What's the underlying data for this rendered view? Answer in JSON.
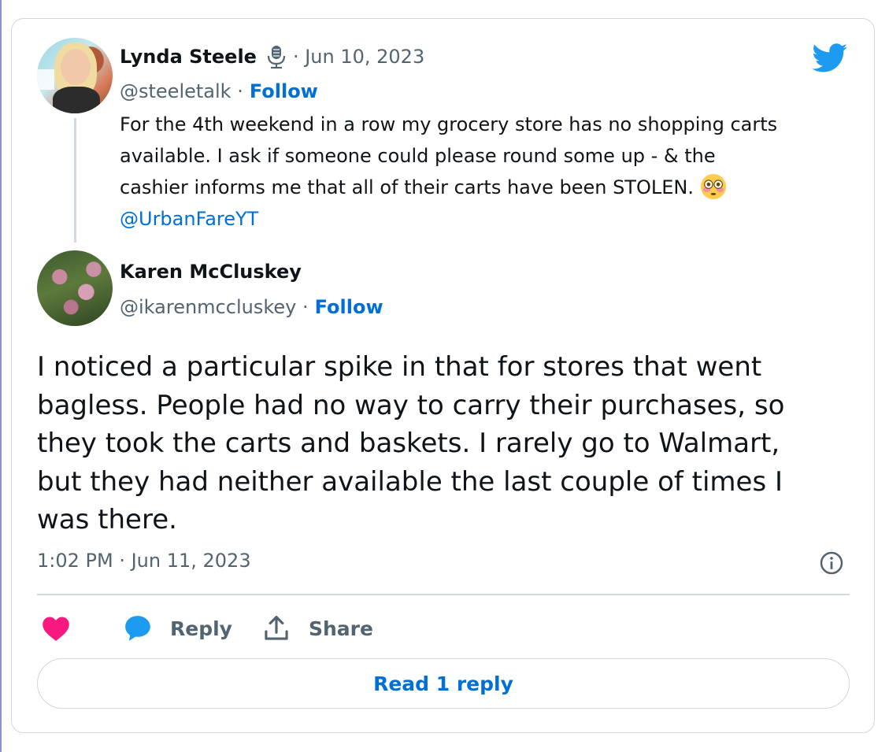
{
  "quoted_tweet": {
    "author_name": "Lynda Steele",
    "date": "· Jun 10, 2023",
    "handle": "@steeletalk ·",
    "follow_label": "Follow",
    "text_lines": [
      "For the 4th weekend in a row my grocery store has no shopping carts",
      "available.  I ask if someone could please round some up - & the",
      "cashier informs me that all of their carts have been STOLEN."
    ],
    "mention": "@UrbanFareYT"
  },
  "reply": {
    "author_name": "Karen McCluskey",
    "handle": "@ikarenmccluskey ·",
    "follow_label": "Follow",
    "text": "I noticed a particular spike in  that for stores that went bagless. People had no way to carry their purchases, so they took the carts and baskets. I rarely go to Walmart, but they had neither available the last couple of times I was there.",
    "timestamp": "1:02 PM · Jun 11, 2023"
  },
  "actions": {
    "reply_label": "Reply",
    "share_label": "Share",
    "read_replies_label": "Read 1 reply"
  },
  "colors": {
    "link": "#006fd6",
    "twitter_blue": "#1d9bf0",
    "like_pink": "#f91880",
    "muted": "#536471",
    "border": "#cfd9de"
  },
  "icons": [
    "twitter-bird-icon",
    "microphone-icon",
    "flushed-face-emoji",
    "info-icon",
    "heart-icon",
    "reply-bubble-icon",
    "share-icon"
  ]
}
